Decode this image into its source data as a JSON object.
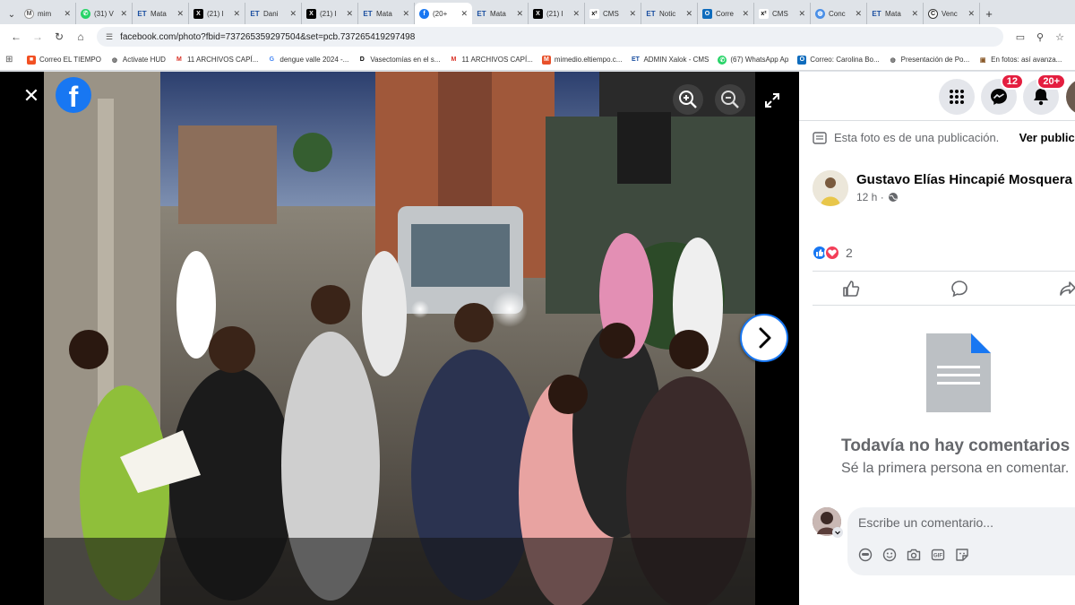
{
  "browser": {
    "tabs": [
      {
        "label": "mim",
        "icon": "gmail-icon"
      },
      {
        "label": "(31) V",
        "icon": "whatsapp-icon"
      },
      {
        "label": "Mata",
        "icon": "eltiempo-icon"
      },
      {
        "label": "(21) I",
        "icon": "x-icon"
      },
      {
        "label": "Dani",
        "icon": "eltiempo-icon"
      },
      {
        "label": "(21) I",
        "icon": "x-icon"
      },
      {
        "label": "Mata",
        "icon": "eltiempo-icon"
      },
      {
        "label": "(20+",
        "icon": "facebook-icon",
        "active": true
      },
      {
        "label": "Mata",
        "icon": "eltiempo-icon"
      },
      {
        "label": "(21) I",
        "icon": "x-icon"
      },
      {
        "label": "CMS",
        "icon": "cms-icon"
      },
      {
        "label": "Notic",
        "icon": "eltiempo-icon"
      },
      {
        "label": "Corre",
        "icon": "outlook-icon"
      },
      {
        "label": "CMS",
        "icon": "cms-icon"
      },
      {
        "label": "Conc",
        "icon": "globe-icon"
      },
      {
        "label": "Mata",
        "icon": "eltiempo-icon"
      },
      {
        "label": "Venc",
        "icon": "circle-c-icon"
      }
    ],
    "url": "facebook.com/photo?fbid=737265359297504&set=pcb.737265419297498",
    "bookmarks": [
      {
        "label": "Correo EL TIEMPO",
        "icon": "windows-icon"
      },
      {
        "label": "Activate HUD",
        "icon": "globe-icon"
      },
      {
        "label": "11 ARCHIVOS CAPÍ...",
        "icon": "gmail-icon"
      },
      {
        "label": "dengue valle 2024 -...",
        "icon": "google-icon"
      },
      {
        "label": "Vasectomías en el s...",
        "icon": "doc-icon"
      },
      {
        "label": "11 ARCHIVOS CAPÍ...",
        "icon": "gmail-icon"
      },
      {
        "label": "mimedio.eltiempo.c...",
        "icon": "m-icon"
      },
      {
        "label": "ADMIN Xalok - CMS",
        "icon": "eltiempo-icon"
      },
      {
        "label": "(67) WhatsApp Ap",
        "icon": "whatsapp-icon"
      },
      {
        "label": "Correo: Carolina Bo...",
        "icon": "outlook-icon"
      },
      {
        "label": "Presentación de Po...",
        "icon": "globe-icon"
      },
      {
        "label": "En fotos: así avanza...",
        "icon": "photo-icon"
      }
    ]
  },
  "viewer": {
    "photo_alt": "Grupo de personas reunidas de noche en una calle de tierra junto a un mototaxi"
  },
  "header": {
    "messenger_badge": "12",
    "notifications_badge": "20+"
  },
  "post": {
    "notice_text": "Esta foto es de una publicación.",
    "notice_link": "Ver publica",
    "author": "Gustavo Elías Hincapié Mosquera",
    "time": "12 h ·",
    "reaction_count": "2",
    "empty_title": "Todavía no hay comentarios",
    "empty_sub": "Sé la primera persona en comentar.",
    "comment_placeholder": "Escribe un comentario..."
  },
  "colors": {
    "facebook_blue": "#1877f2",
    "badge_red": "#e41e3f",
    "text_secondary": "#65676b"
  }
}
